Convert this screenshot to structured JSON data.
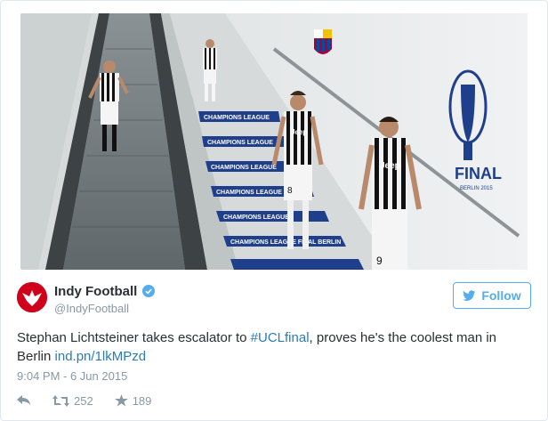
{
  "media": {
    "signs": [
      "CHAMPIONS LEAGUE",
      "CHAMPIONS LEAGUE",
      "CHAMPIONS LEAGUE",
      "CHAMPIONS LEAGUE",
      "CHAMPIONS LEAGUE",
      "CHAMPIONS LEAGUE",
      "CHAMPIONS LEAGUE",
      "CHAMPIONS LEAGUE FINAL BERLIN"
    ],
    "final_text": "FINAL",
    "final_sub": "BERLIN 2015",
    "shirt_text": "Jeep",
    "numbers": [
      "8",
      "9"
    ]
  },
  "author": {
    "name": "Indy Football",
    "handle": "@IndyFootball"
  },
  "follow_label": "Follow",
  "tweet": {
    "text_before": "Stephan Lichtsteiner takes escalator to ",
    "hashtag": "#UCLfinal",
    "text_after": ", proves he's the coolest man in Berlin ",
    "link": "ind.pn/1lkMPzd"
  },
  "timestamp": "9:04 PM - 6 Jun 2015",
  "stats": {
    "retweets": "252",
    "favorites": "189"
  },
  "colors": {
    "accent": "#55acee",
    "link": "#2b7bb9",
    "muted": "#8899a6",
    "text": "#292f33",
    "avatar": "#d0021b"
  },
  "icons": [
    "verified-icon",
    "twitter-bird-icon",
    "reply-icon",
    "retweet-icon",
    "favorite-icon",
    "eagle-logo-icon"
  ]
}
